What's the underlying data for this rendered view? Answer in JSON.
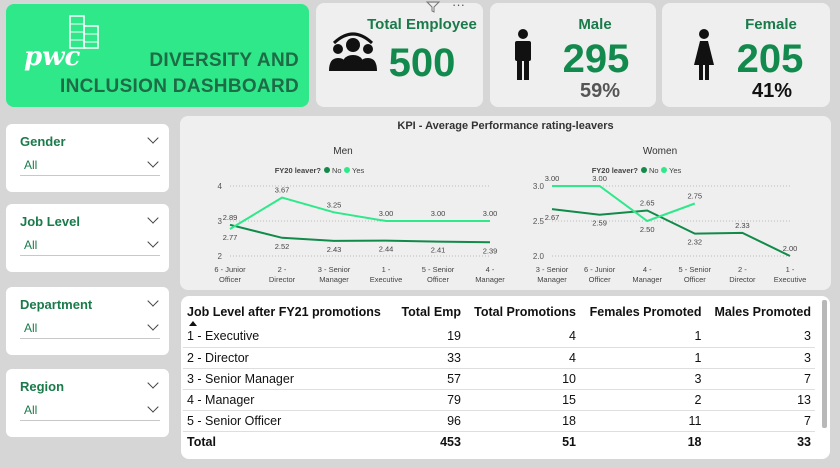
{
  "title": {
    "brand": "pwc",
    "line1": "DIVERSITY AND",
    "line2": "INCLUSION DASHBOARD"
  },
  "kpis": {
    "total": {
      "label": "Total Employee",
      "value": "500"
    },
    "male": {
      "label": "Male",
      "value": "295",
      "pct": "59%"
    },
    "female": {
      "label": "Female",
      "value": "205",
      "pct": "41%"
    }
  },
  "filters": [
    {
      "label": "Gender",
      "value": "All"
    },
    {
      "label": "Job Level",
      "value": "All"
    },
    {
      "label": "Department",
      "value": "All"
    },
    {
      "label": "Region",
      "value": "All"
    }
  ],
  "chart_data": [
    {
      "type": "line",
      "title": "Men",
      "legend_title": "FY20 leaver?",
      "categories": [
        "6 - Junior Officer",
        "2 - Director",
        "3 - Senior Manager",
        "1 - Executive",
        "5 - Senior Officer",
        "4 - Manager"
      ],
      "series": [
        {
          "name": "No",
          "color": "#118a4a",
          "values": [
            2.89,
            2.52,
            2.43,
            2.44,
            2.41,
            2.39
          ]
        },
        {
          "name": "Yes",
          "color": "#2ee88a",
          "values": [
            2.77,
            3.67,
            3.25,
            3.0,
            3.0,
            3.0
          ]
        }
      ],
      "data_labels_no": [
        "2.89",
        "2.52",
        "2.43",
        "2.44",
        "2.41",
        "2.39"
      ],
      "data_labels_yes": [
        "2.77",
        "3.67",
        "3.25",
        "3.00",
        "3.00",
        "3.00"
      ],
      "yticks": [
        "4",
        "3",
        "2"
      ],
      "ylim": [
        2,
        4
      ],
      "grid": true,
      "legend_position": "top"
    },
    {
      "type": "line",
      "title": "Women",
      "legend_title": "FY20 leaver?",
      "categories": [
        "3 - Senior Manager",
        "6 - Junior Officer",
        "4 - Manager",
        "5 - Senior Officer",
        "2 - Director",
        "1 - Executive"
      ],
      "series": [
        {
          "name": "No",
          "color": "#118a4a",
          "values": [
            2.67,
            2.59,
            2.65,
            2.32,
            2.33,
            2.0
          ]
        },
        {
          "name": "Yes",
          "color": "#2ee88a",
          "values": [
            3.0,
            3.0,
            2.5,
            2.75,
            null,
            null
          ]
        }
      ],
      "data_labels_no": [
        "2.67",
        "2.59",
        "2.65",
        "2.32",
        "2.33",
        "2.00"
      ],
      "data_labels_yes": [
        "3.00",
        "3.00",
        "2.50",
        "2.75",
        "",
        ""
      ],
      "yticks": [
        "3.0",
        "2.5",
        "2.0"
      ],
      "ylim": [
        2,
        3
      ],
      "grid": true,
      "legend_position": "top"
    }
  ],
  "chart_card": {
    "title": "KPI - Average Performance rating-leavers"
  },
  "table": {
    "headers": [
      "Job Level after FY21 promotions",
      "Total Emp",
      "Total Promotions",
      "Females Promoted",
      "Males Promoted"
    ],
    "rows": [
      [
        "1 - Executive",
        "19",
        "4",
        "1",
        "3"
      ],
      [
        "2 - Director",
        "33",
        "4",
        "1",
        "3"
      ],
      [
        "3 - Senior Manager",
        "57",
        "10",
        "3",
        "7"
      ],
      [
        "4 - Manager",
        "79",
        "15",
        "2",
        "13"
      ],
      [
        "5 - Senior Officer",
        "96",
        "18",
        "11",
        "7"
      ]
    ],
    "total": [
      "Total",
      "453",
      "51",
      "18",
      "33"
    ]
  },
  "colors": {
    "accent": "#2ee88a",
    "dark_green": "#118a4a",
    "kpi_text": "#1a7a4a"
  },
  "header_icons": [
    "filter-icon",
    "more-options-icon"
  ]
}
